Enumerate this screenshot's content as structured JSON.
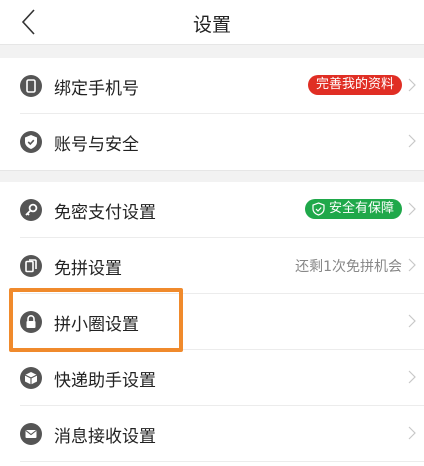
{
  "header": {
    "title": "设置"
  },
  "sections": [
    {
      "items": [
        {
          "label": "绑定手机号",
          "icon": "phone-icon",
          "badge": "完善我的资料",
          "badge_color": "#e02e24"
        },
        {
          "label": "账号与安全",
          "icon": "shield-check-icon"
        }
      ]
    },
    {
      "items": [
        {
          "label": "免密支付设置",
          "icon": "key-icon",
          "badge": "安全有保障",
          "badge_color": "#1fa84a"
        },
        {
          "label": "免拼设置",
          "icon": "coupon-icon",
          "status": "还剩1次免拼机会"
        },
        {
          "label": "拼小圈设置",
          "icon": "lock-icon"
        },
        {
          "label": "快递助手设置",
          "icon": "package-icon"
        },
        {
          "label": "消息接收设置",
          "icon": "mail-icon"
        }
      ]
    }
  ],
  "colors": {
    "highlight": "#f08a2c",
    "icon_gray": "#555555",
    "divider": "#ececec",
    "section_gap": "#f2f2f2"
  }
}
